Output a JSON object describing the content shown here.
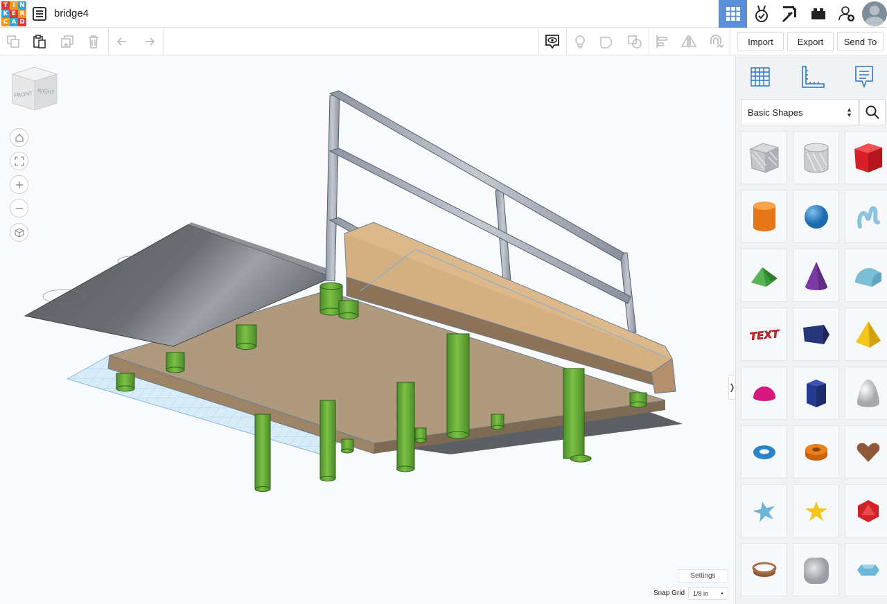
{
  "app": {
    "logo_letters": [
      "T",
      "I",
      "N",
      "K",
      "E",
      "R",
      "C",
      "A",
      "D"
    ],
    "logo_colors": [
      "#e33a2f",
      "#f39b1e",
      "#3ba0d4",
      "#3ba0d4",
      "#e33a2f",
      "#f39b1e",
      "#f39b1e",
      "#3ba0d4",
      "#e33a2f"
    ],
    "document_title": "bridge4",
    "accent_color": "#5a8fd8"
  },
  "topbar": {
    "icons": [
      "3d-design-grid-icon",
      "circuits-icon",
      "minecraft-pickaxe-icon",
      "lego-brick-icon",
      "add-user-icon",
      "user-avatar"
    ]
  },
  "toolbar": {
    "icons": [
      "copy-icon",
      "paste-icon",
      "duplicate-icon",
      "delete-icon",
      "undo-icon",
      "redo-icon",
      "notes-visibility-icon",
      "lightbulb-icon",
      "group-icon",
      "ungroup-icon",
      "align-icon",
      "mirror-icon",
      "magnet-icon"
    ],
    "import_label": "Import",
    "export_label": "Export",
    "send_to_label": "Send To"
  },
  "viewport": {
    "viewcube_front": "FRONT",
    "viewcube_right": "RIGHT",
    "nav_icons": [
      "home-view-icon",
      "fit-all-icon",
      "zoom-in-icon",
      "zoom-out-icon",
      "perspective-icon"
    ],
    "settings_label": "Settings",
    "snap_grid_label": "Snap Grid",
    "snap_grid_value": "1/8 in"
  },
  "panel": {
    "tabs": [
      "workplane-icon",
      "ruler-icon",
      "notes-icon"
    ],
    "category": "Basic Shapes",
    "shapes": [
      {
        "name": "box-hole",
        "color": "#b9bcc2"
      },
      {
        "name": "cylinder-hole",
        "color": "#c9ccd1"
      },
      {
        "name": "box",
        "color": "#e0232d"
      },
      {
        "name": "cylinder",
        "color": "#ea7f1e"
      },
      {
        "name": "sphere",
        "color": "#2a85c8"
      },
      {
        "name": "scribble",
        "color": "#8fc2e0"
      },
      {
        "name": "roof",
        "color": "#3c9a3c"
      },
      {
        "name": "cone",
        "color": "#7b3aa3"
      },
      {
        "name": "round-roof",
        "color": "#7bbed6"
      },
      {
        "name": "text",
        "color": "#d42027"
      },
      {
        "name": "polygon",
        "color": "#27367a"
      },
      {
        "name": "pyramid",
        "color": "#f3c41b"
      },
      {
        "name": "half-sphere",
        "color": "#d6187f"
      },
      {
        "name": "polygon-prism",
        "color": "#263b8e"
      },
      {
        "name": "paraboloid",
        "color": "#cfd1d4"
      },
      {
        "name": "torus",
        "color": "#2a85c8"
      },
      {
        "name": "tube",
        "color": "#ea7f1e"
      },
      {
        "name": "heart",
        "color": "#8e5a3a"
      },
      {
        "name": "star",
        "color": "#6bb6d6"
      },
      {
        "name": "star-yellow",
        "color": "#f3c41b"
      },
      {
        "name": "icosahedron",
        "color": "#d42027"
      },
      {
        "name": "ring",
        "color": "#8e5a3a"
      },
      {
        "name": "rounded-box",
        "color": "#b9bcc2"
      },
      {
        "name": "diamond",
        "color": "#6bb6d6"
      }
    ],
    "text_tile_label": "TEXT"
  }
}
